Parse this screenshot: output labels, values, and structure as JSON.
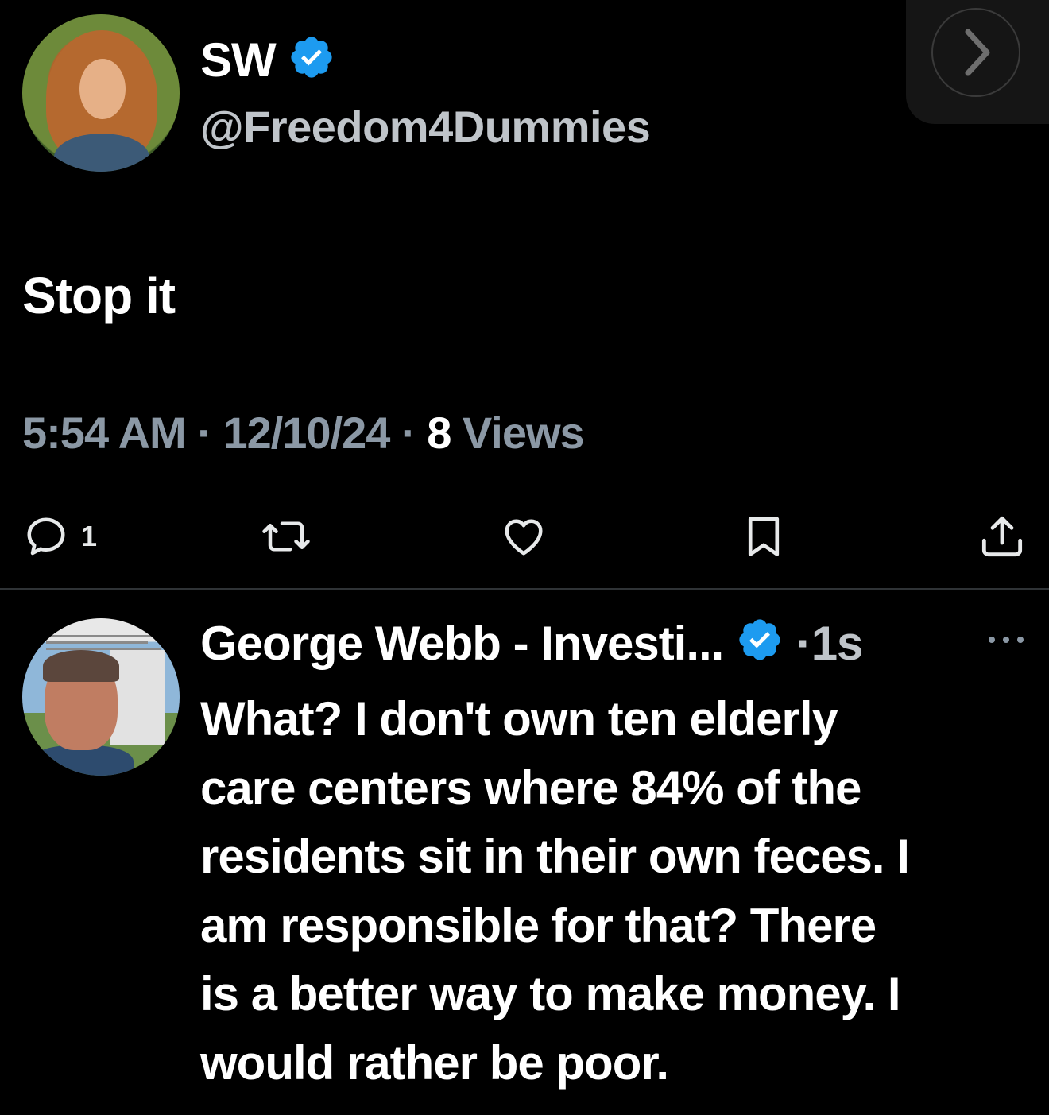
{
  "tweet": {
    "author_name": "SW",
    "author_handle": "@Freedom4Dummies",
    "verified_icon": "verified-badge-icon",
    "text": "Stop it",
    "time": "5:54 AM",
    "separator": "·",
    "date": "12/10/24",
    "views_count": "8",
    "views_label": "Views",
    "reply_count": "1",
    "actions": [
      "reply-icon",
      "retweet-icon",
      "like-icon",
      "bookmark-icon",
      "share-icon"
    ]
  },
  "nav": {
    "next_icon": "chevron-right-icon"
  },
  "reply": {
    "author_name": "George Webb - Investi...",
    "separator": "·",
    "time": "1s",
    "more_icon": "more-icon",
    "text": "What?  I don't own ten elderly\ncare centers where 84% of the\nresidents sit in their own feces. I\nam responsible for that?  There\nis a better way to make money. I\nwould rather be poor."
  },
  "colors": {
    "background": "#000000",
    "primary_text": "#ffffff",
    "secondary_text": "#8b98a5",
    "verified_blue": "#1d9bf0",
    "divider": "#2f3336"
  }
}
